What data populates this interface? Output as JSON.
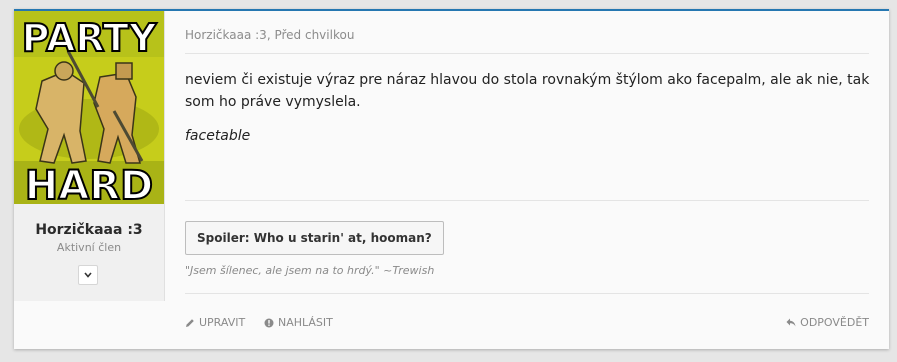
{
  "avatar": {
    "top_text": "PARTY",
    "bottom_text": "HARD",
    "bg_color": "#c6cd1b"
  },
  "user": {
    "name": "Horzičkaaa :3",
    "title": "Aktivní člen",
    "toggle_icon": "chevron-down-icon"
  },
  "post": {
    "author": "Horzičkaaa :3",
    "separator": ", ",
    "time": "Před chvilkou",
    "body": "neviem či existuje výraz pre náraz hlavou do stola rovnakým štýlom ako facepalm, ale ak nie, tak som ho práve vymyslela.",
    "italic": "facetable",
    "spoiler_label": "Spoiler: Who u starin' at, hooman?",
    "signature": "\"Jsem šílenec, ale jsem na to hrdý.\" ~Trewish"
  },
  "actions": {
    "edit": "UPRAVIT",
    "report": "NAHLÁSIT",
    "reply": "ODPOVĚDĚT"
  },
  "colors": {
    "accent": "#2577b1",
    "page_bg": "#e6e6e6",
    "card_bg": "#fafafa"
  }
}
